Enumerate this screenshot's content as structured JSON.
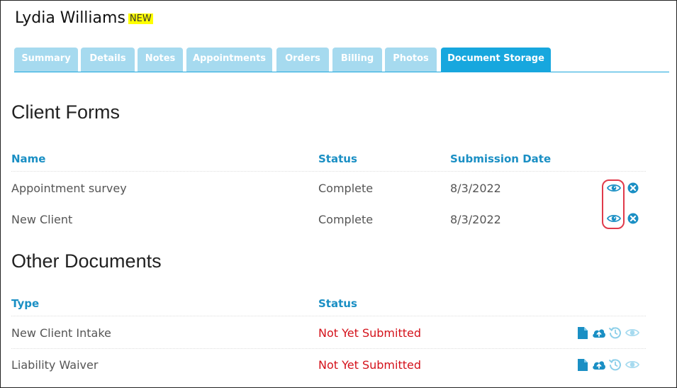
{
  "client": {
    "name": "Lydia Williams",
    "badge": "NEW"
  },
  "tabs": [
    {
      "label": "Summary"
    },
    {
      "label": "Details"
    },
    {
      "label": "Notes"
    },
    {
      "label": "Appointments"
    },
    {
      "label": "Orders"
    },
    {
      "label": "Billing"
    },
    {
      "label": "Photos"
    },
    {
      "label": "Document Storage",
      "active": true
    }
  ],
  "client_forms": {
    "title": "Client Forms",
    "columns": [
      "Name",
      "Status",
      "Submission Date"
    ],
    "rows": [
      {
        "name": "Appointment survey",
        "status": "Complete",
        "date": "8/3/2022"
      },
      {
        "name": "New Client",
        "status": "Complete",
        "date": "8/3/2022"
      }
    ]
  },
  "other_documents": {
    "title": "Other Documents",
    "columns": [
      "Type",
      "Status"
    ],
    "rows": [
      {
        "type": "New Client Intake",
        "status": "Not Yet Submitted"
      },
      {
        "type": "Liability Waiver",
        "status": "Not Yet Submitted"
      }
    ]
  },
  "colors": {
    "accent": "#17a7de",
    "tab_inactive": "#a6daef",
    "heading_blue": "#1a8fc4",
    "error_red": "#d4111a",
    "highlight": "#e03a4a"
  },
  "icons": [
    "eye-icon",
    "delete-circle-icon",
    "file-icon",
    "cloud-upload-icon",
    "history-icon"
  ]
}
